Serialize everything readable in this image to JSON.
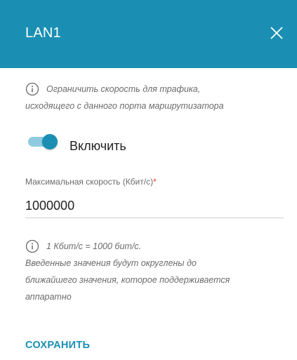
{
  "colors": {
    "accent": "#1a8fb3",
    "required": "#e53935"
  },
  "header": {
    "title": "LAN1",
    "close_icon": "close-icon"
  },
  "info_top": {
    "icon": "info-icon",
    "line1": "Ограничить скорость для трафика,",
    "line2": "исходящего с данного порта маршрутизатора"
  },
  "toggle": {
    "label": "Включить",
    "state": "on"
  },
  "speed_field": {
    "label": "Максимальная скорость (Кбит/с)",
    "required_mark": "*",
    "value": "1000000"
  },
  "info_bottom": {
    "icon": "info-icon",
    "line1": "1 Кбит/с = 1000 бит/с.",
    "line2": "Введенные значения будут округлены до",
    "line3": "ближайшего значения, которое поддерживается",
    "line4": "аппаратно"
  },
  "actions": {
    "save_label": "СОХРАНИТЬ"
  }
}
